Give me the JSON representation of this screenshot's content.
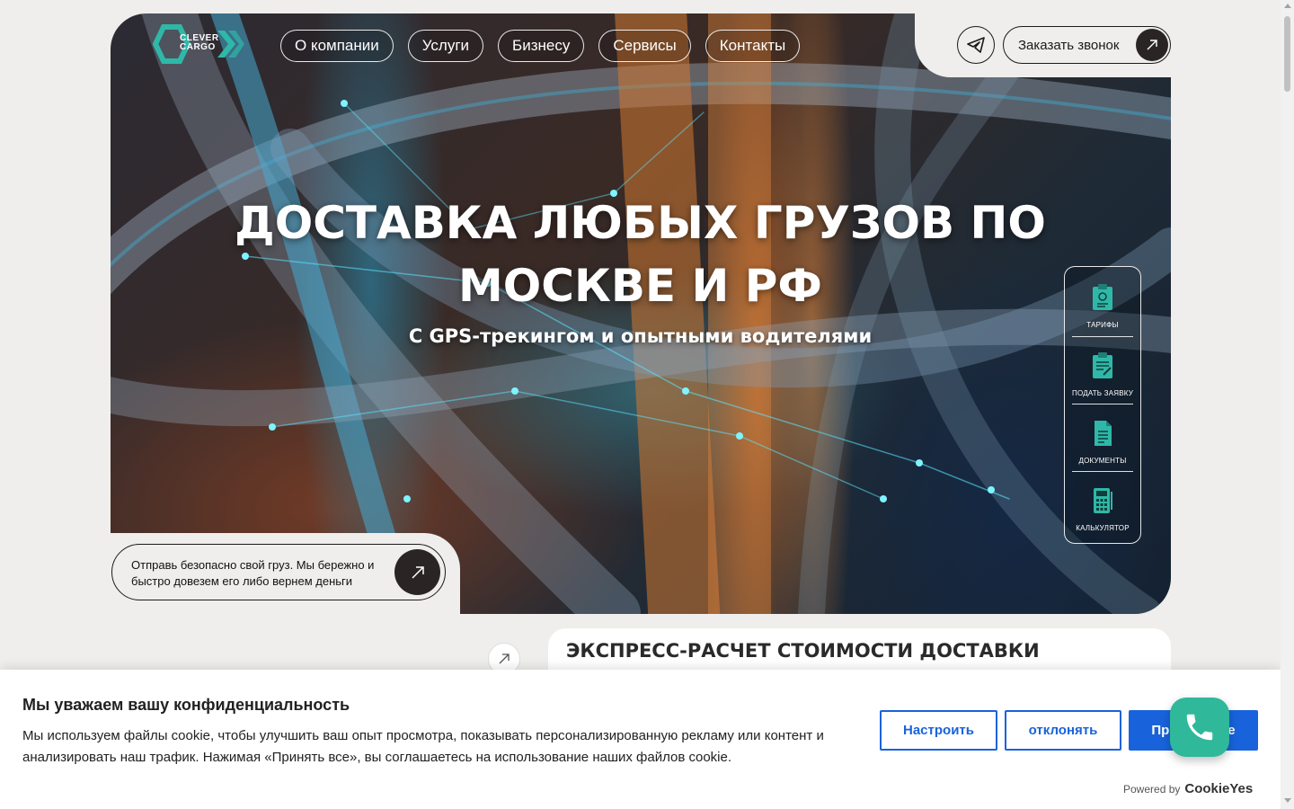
{
  "brand": {
    "logo_text": [
      "CLEVER",
      "CARGO"
    ],
    "accent": "#2fb8a8"
  },
  "nav": {
    "items": [
      {
        "label": "О компании"
      },
      {
        "label": "Услуги"
      },
      {
        "label": "Бизнесу"
      },
      {
        "label": "Сервисы"
      },
      {
        "label": "Контакты"
      }
    ]
  },
  "header": {
    "telegram_icon": "telegram-icon",
    "call_label": "Заказать звонок"
  },
  "hero": {
    "title": "ДОСТАВКА ЛЮБЫХ ГРУЗОВ ПО МОСКВЕ И РФ",
    "subtitle": "С GPS-трекингом и опытными водителями",
    "promo": "Отправь безопасно свой груз. Мы бережно и быстро довезем его либо вернем деньги"
  },
  "side_menu": {
    "items": [
      {
        "label": "ТАРИФЫ",
        "icon": "tariff-icon"
      },
      {
        "label": "ПОДАТЬ ЗАЯВКУ",
        "icon": "application-icon"
      },
      {
        "label": "ДОКУМЕНТЫ",
        "icon": "documents-icon"
      },
      {
        "label": "КАЛЬКУЛЯТОР",
        "icon": "calculator-icon"
      }
    ]
  },
  "calc": {
    "title": "ЭКСПРЕСС-РАСЧЕТ СТОИМОСТИ ДОСТАВКИ"
  },
  "cookie": {
    "title": "Мы уважаем вашу конфиденциальность",
    "text": "Мы используем файлы cookie, чтобы улучшить ваш опыт просмотра, показывать персонализированную рекламу или контент и анализировать наш трафик. Нажимая «Принять все», вы соглашаетесь на использование наших файлов cookie.",
    "customize": "Настроить",
    "reject": "отклонять",
    "accept": "Принять все",
    "powered_by": "Powered by",
    "powered_brand": "CookieYes",
    "accent": "#1863dc"
  }
}
